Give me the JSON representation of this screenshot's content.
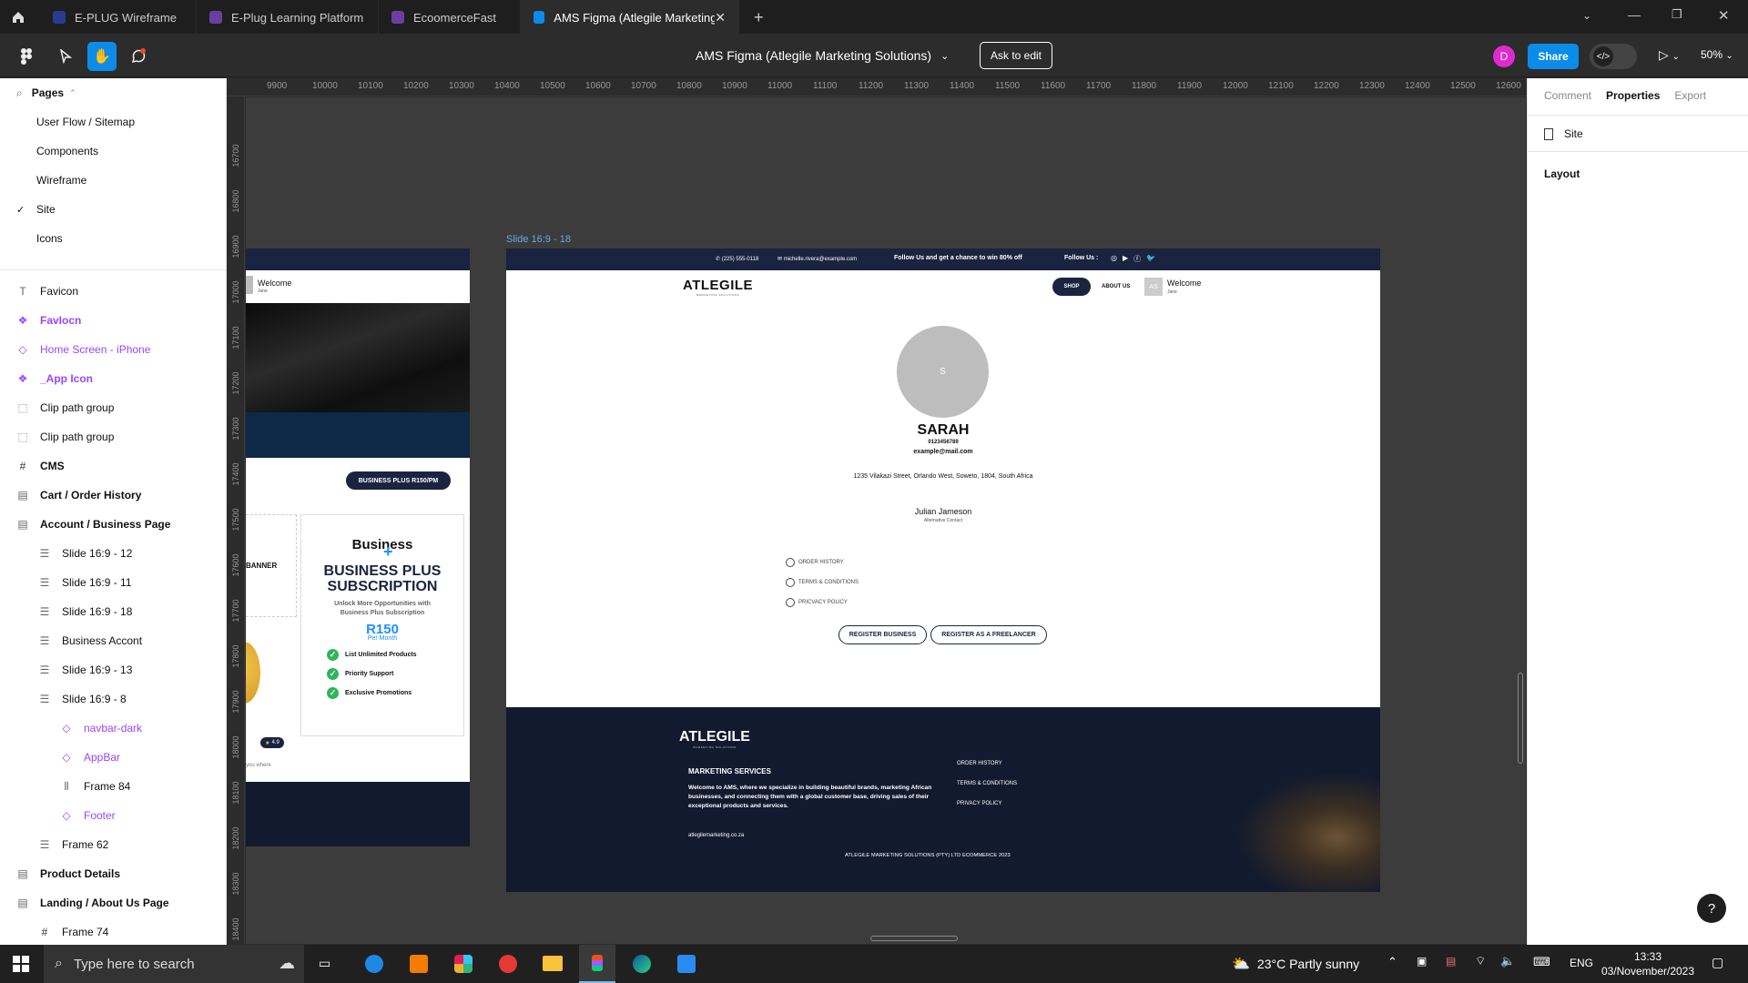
{
  "tabs": [
    {
      "label": "E-PLUG Wireframe"
    },
    {
      "label": "E-Plug Learning Platform"
    },
    {
      "label": "EcoomerceFast"
    },
    {
      "label": "AMS Figma (Atlegile Marketing Sol"
    }
  ],
  "toolbar": {
    "doc_title": "AMS Figma (Atlegile Marketing Solutions)",
    "ask_to_edit": "Ask to edit",
    "avatar_initial": "D",
    "share": "Share",
    "zoom": "50%"
  },
  "left": {
    "pages_title": "Pages",
    "pages": [
      "User Flow / Sitemap",
      "Components",
      "Wireframe",
      "Site",
      "Icons"
    ],
    "current_page": "Site",
    "layers": [
      {
        "label": "Favicon",
        "indent": 0,
        "type": "text"
      },
      {
        "label": "FavIocn",
        "indent": 0,
        "type": "component"
      },
      {
        "label": "Home Screen - iPhone",
        "indent": 0,
        "type": "instance"
      },
      {
        "label": "_App Icon",
        "indent": 0,
        "type": "component"
      },
      {
        "label": "Clip path group",
        "indent": 0,
        "type": "group"
      },
      {
        "label": "Clip path group",
        "indent": 0,
        "type": "group"
      },
      {
        "label": "CMS",
        "indent": 0,
        "type": "frame"
      },
      {
        "label": "Cart / Order History",
        "indent": 0,
        "type": "section"
      },
      {
        "label": "Account / Business Page",
        "indent": 0,
        "type": "section"
      },
      {
        "label": "Slide 16:9 - 12",
        "indent": 1,
        "type": "layout"
      },
      {
        "label": "Slide 16:9 - 11",
        "indent": 1,
        "type": "layout"
      },
      {
        "label": "Slide 16:9 - 18",
        "indent": 1,
        "type": "layout"
      },
      {
        "label": "Business Accont",
        "indent": 1,
        "type": "layout"
      },
      {
        "label": "Slide 16:9 - 13",
        "indent": 1,
        "type": "layout"
      },
      {
        "label": "Slide 16:9 - 8",
        "indent": 1,
        "type": "layout"
      },
      {
        "label": "navbar-dark",
        "indent": 2,
        "type": "instance"
      },
      {
        "label": "AppBar",
        "indent": 2,
        "type": "instance"
      },
      {
        "label": "Frame 84",
        "indent": 2,
        "type": "hframe"
      },
      {
        "label": "Footer",
        "indent": 2,
        "type": "instance"
      },
      {
        "label": "Frame 62",
        "indent": 1,
        "type": "layout"
      },
      {
        "label": "Product Details",
        "indent": 0,
        "type": "section"
      },
      {
        "label": "Landing / About Us Page",
        "indent": 0,
        "type": "section"
      },
      {
        "label": "Frame 74",
        "indent": 1,
        "type": "frame"
      }
    ]
  },
  "right": {
    "tabs": [
      "Comment",
      "Properties",
      "Export"
    ],
    "active_tab": "Properties",
    "selection": "Site",
    "layout_label": "Layout"
  },
  "ruler": [
    "9900",
    "10000",
    "10100",
    "10200",
    "10300",
    "10400",
    "10500",
    "10600",
    "10700",
    "10800",
    "10900",
    "11000",
    "11100",
    "11200",
    "11300",
    "11400",
    "11500",
    "11600",
    "11700",
    "11800",
    "11900",
    "12000",
    "12100",
    "12200",
    "12300",
    "12400",
    "12500",
    "12600"
  ],
  "vruler": [
    "16700",
    "16800",
    "16900",
    "17000",
    "17100",
    "17200",
    "17300",
    "17400",
    "17500",
    "17600",
    "17700",
    "17800",
    "17900",
    "18000",
    "18100",
    "18200",
    "18300",
    "18400"
  ],
  "frame_label": "Slide 16:9 - 18",
  "slide": {
    "topbar": {
      "phone": "(225) 555-0118",
      "email": "michelle.rivera@example.com",
      "promo": "Follow Us  and get a chance to win 80% off",
      "follow": "Follow Us :"
    },
    "logo": "ATLEGILE",
    "logo_sub": "MARKETING SOLUTIONS",
    "nav": {
      "shop": "SHOP",
      "about": "ABOUT US",
      "avatar": "AS",
      "welcome": "Welcome",
      "user": "Jane"
    },
    "profile": {
      "initial": "S",
      "name": "SARAH",
      "phone": "0123456789",
      "email": "example@mail.com",
      "address": "1235 Vilakazi Street, Orlando West, Soweto, 1804, South Africa",
      "alt_name": "Julian Jameson",
      "alt_label": "Alternative Contact"
    },
    "links": [
      "ORDER HISTORY",
      "TERMS & CONDITIONS",
      "PRICVACY POLICY"
    ],
    "buttons": [
      "REGISTER BUSINESS",
      "REGISTER AS A FREELANCER"
    ],
    "footer": {
      "title": "MARKETING SERVICES",
      "body": "Welcome to AMS, where we specialize in building beautiful brands, marketing African businesses, and connecting them with a global customer base, driving sales of their exceptional products and services.",
      "site": "atlegilemarketing.co.za",
      "links": [
        "ORDER HISTORY",
        "TERMS & CONDITIONS",
        "PRIVACY POLICY"
      ],
      "copyright": "ATLEGILE MARKETING SOLUTIONS (PTY) LTD ECOMMERCE 2023"
    }
  },
  "left_frame": {
    "welcome": "Welcome",
    "user": "Jane",
    "badge": "BUSINESS PLUS R150/PM",
    "banner": "BANNER",
    "card": {
      "logo": "Business",
      "title1": "BUSINESS PLUS",
      "title2": "SUBSCRIPTION",
      "sub": "Unlock More Opportunities with Business Plus Subscription",
      "price": "R150",
      "per": "Per Month",
      "features": [
        "List Unlimited Products",
        "Priority Support",
        "Exclusive Promotions"
      ]
    },
    "rating": "4.9",
    "fragment": "you where"
  },
  "taskbar": {
    "search": "Type here to search",
    "weather": "23°C  Partly sunny",
    "lang": "ENG",
    "time": "13:33",
    "date": "03/November/2023"
  },
  "colors": {
    "accent": "#0c8ce9",
    "navy": "#1a2340",
    "footer": "#111a2e",
    "figma_purple": "#9747ff"
  }
}
